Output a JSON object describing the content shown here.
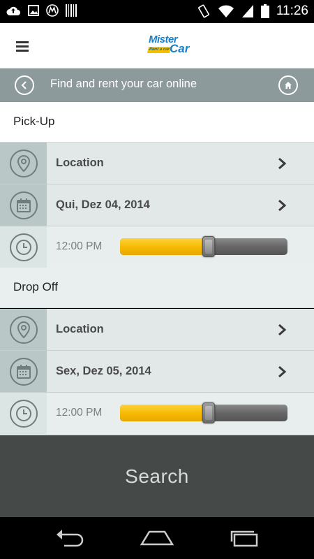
{
  "status_bar": {
    "time": "11:26",
    "left_icons": [
      "cloud-upload-icon",
      "image-icon",
      "motorola-icon",
      "barcode-icon"
    ],
    "right_icons": [
      "vibrate-icon",
      "wifi-icon",
      "cell-signal-icon",
      "battery-icon"
    ]
  },
  "app_bar": {
    "logo_line1": "Mister",
    "logo_line2": "Car",
    "logo_tag": "Rent a car",
    "menu_icon": "hamburger-menu-icon"
  },
  "title_bar": {
    "title": "Find and rent your car online",
    "back_icon": "chevron-left-icon",
    "home_icon": "home-icon"
  },
  "pickup": {
    "heading": "Pick-Up",
    "location_label": "Location",
    "date_label": "Qui, Dez 04, 2014",
    "time_label": "12:00 PM",
    "time_slider_value": 0.53
  },
  "dropoff": {
    "heading": "Drop Off",
    "location_label": "Location",
    "date_label": "Sex, Dez 05, 2014",
    "time_label": "12:00 PM",
    "time_slider_value": 0.53
  },
  "search_label": "Search",
  "nav_bar": {
    "buttons": [
      "back-icon",
      "home-icon",
      "recent-apps-icon"
    ]
  },
  "colors": {
    "title_bar": "#8d9a9b",
    "slider_fill": "#f6b900",
    "search_bg": "#454a49",
    "brand_blue": "#1a7fc8"
  }
}
